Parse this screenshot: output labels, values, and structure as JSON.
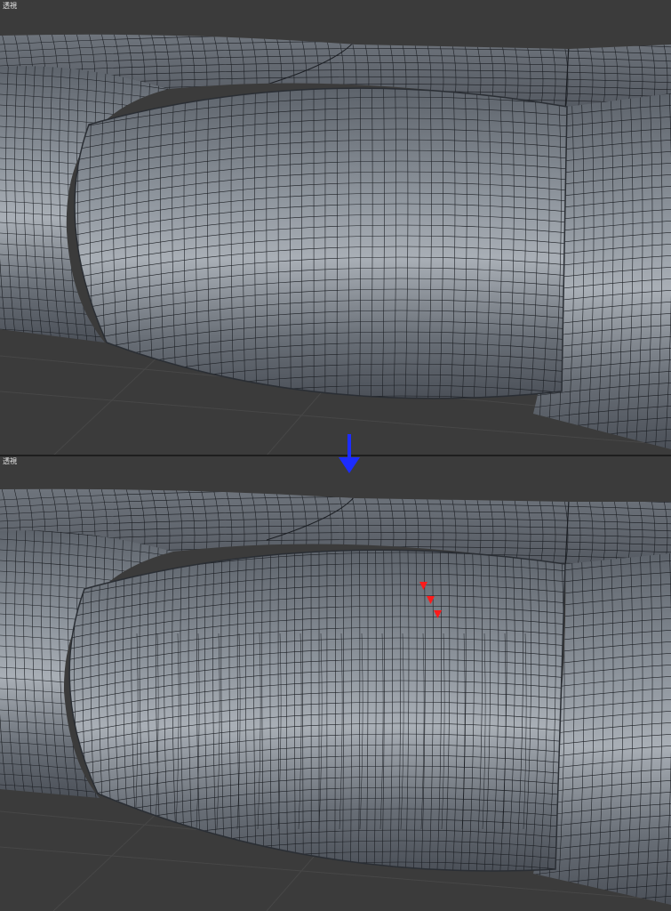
{
  "viewports": [
    {
      "id": "top",
      "label": "透視",
      "state": "before"
    },
    {
      "id": "bottom",
      "label": "透視",
      "state": "after"
    }
  ],
  "colors": {
    "background": "#3b3b3b",
    "floor_grid": "#4a4a4a",
    "mesh_base": "#7c838c",
    "mesh_highlight": "#a9afb6",
    "mesh_shadow": "#4b5058",
    "wire": "#1c1f24",
    "arrow": "#1c2cff",
    "markers": "#ff1a1a"
  },
  "icons": {
    "transition": "arrow-down-icon",
    "marker": "triangle-down-icon"
  },
  "marker_count": 3
}
